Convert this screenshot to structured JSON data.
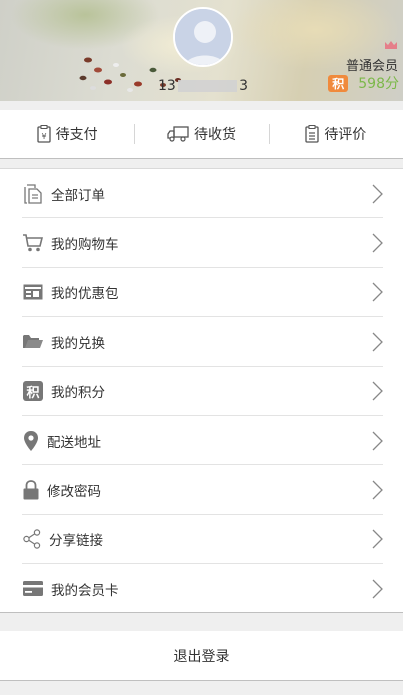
{
  "header": {
    "phone_prefix": "13",
    "phone_suffix": "3",
    "member_level": "普通会员",
    "points_badge": "积",
    "points_value": "598分"
  },
  "status_tabs": [
    {
      "label": "待支付",
      "icon": "payment-doc-icon"
    },
    {
      "label": "待收货",
      "icon": "truck-icon"
    },
    {
      "label": "待评价",
      "icon": "clipboard-icon"
    }
  ],
  "menu": [
    {
      "label": "全部订单",
      "icon": "document-icon"
    },
    {
      "label": "我的购物车",
      "icon": "cart-icon"
    },
    {
      "label": "我的优惠包",
      "icon": "coupon-icon"
    },
    {
      "label": "我的兑换",
      "icon": "folder-icon"
    },
    {
      "label": "我的积分",
      "icon": "points-icon",
      "badge": "积"
    },
    {
      "label": "配送地址",
      "icon": "location-pin-icon"
    },
    {
      "label": "修改密码",
      "icon": "lock-icon"
    },
    {
      "label": "分享链接",
      "icon": "share-icon"
    },
    {
      "label": "我的会员卡",
      "icon": "card-icon"
    }
  ],
  "logout_label": "退出登录",
  "colors": {
    "points_badge": "#f08a3c",
    "points_text": "#7cb84a",
    "icon_gray": "#777777"
  }
}
